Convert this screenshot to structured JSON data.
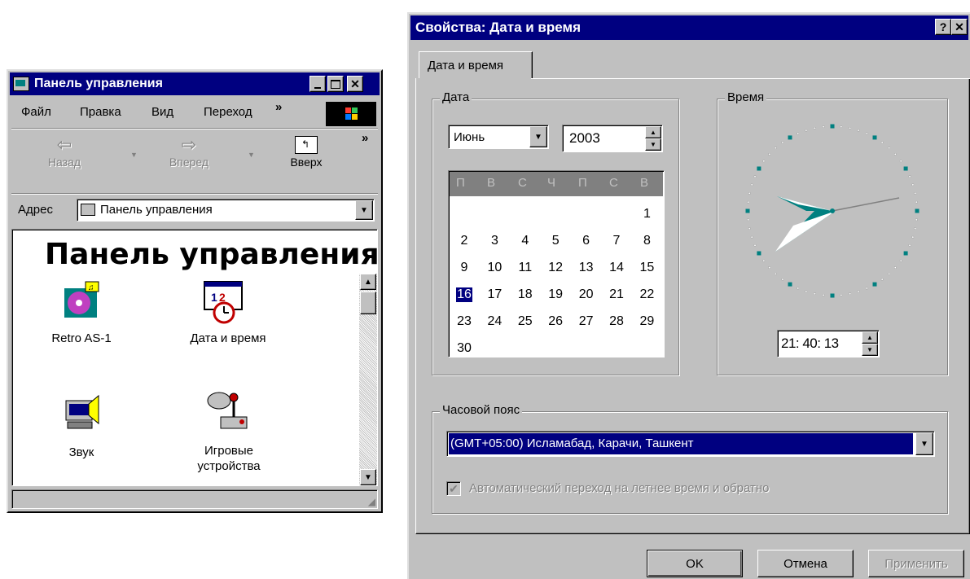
{
  "control_panel": {
    "title": "Панель управления",
    "menu": [
      "Файл",
      "Правка",
      "Вид",
      "Переход"
    ],
    "menu_more": "»",
    "toolbar": {
      "back": "Назад",
      "forward": "Вперед",
      "up": "Вверх",
      "more": "»"
    },
    "address_label": "Адрес",
    "address_value": "Панель управления",
    "heading": "Панель управления",
    "icons": [
      {
        "label": "Retro AS-1",
        "icon": "multimedia-icon"
      },
      {
        "label": "Дата и время",
        "icon": "calendar-clock-icon"
      },
      {
        "label": "Звук",
        "icon": "speaker-icon"
      },
      {
        "label": "Игровые устройства",
        "icon": "joystick-icon"
      }
    ]
  },
  "dialog": {
    "title": "Свойства: Дата и время",
    "help_btn": "?",
    "close_btn": "✕",
    "tab": "Дата и время",
    "date_group": "Дата",
    "month": "Июнь",
    "year": "2003",
    "weekdays": [
      "П",
      "В",
      "С",
      "Ч",
      "П",
      "С",
      "В"
    ],
    "days": [
      "1",
      "2",
      "3",
      "4",
      "5",
      "6",
      "7",
      "8",
      "9",
      "10",
      "11",
      "12",
      "13",
      "14",
      "15",
      "16",
      "17",
      "18",
      "19",
      "20",
      "21",
      "22",
      "23",
      "24",
      "25",
      "26",
      "27",
      "28",
      "29",
      "30"
    ],
    "selected_day": "16",
    "time_group": "Время",
    "time_value": "21: 40: 13",
    "timezone_group": "Часовой пояс",
    "timezone": "(GMT+05:00) Исламабад, Карачи, Ташкент",
    "dst_checkbox": "Автоматический переход на летнее время и обратно",
    "dst_checked": true,
    "buttons": {
      "ok": "OK",
      "cancel": "Отмена",
      "apply": "Применить"
    }
  },
  "colors": {
    "titlebar": "#000080",
    "face": "#c0c0c0",
    "selection": "#000080",
    "clock_marks": "#008080"
  }
}
